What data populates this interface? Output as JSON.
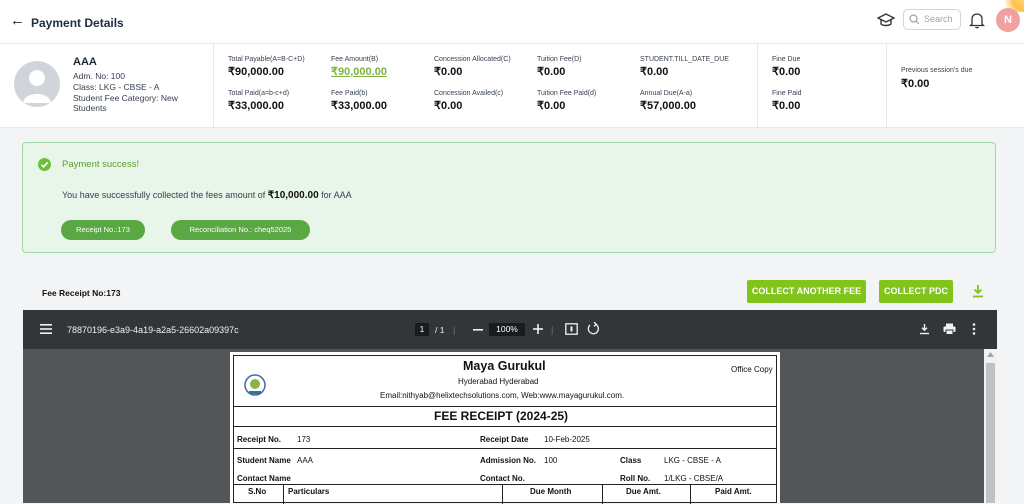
{
  "header": {
    "title": "Payment Details",
    "search_placeholder": "Search",
    "avatar_initial": "N"
  },
  "student": {
    "name": "AAA",
    "adm": "Adm. No: 100",
    "class": "Class: LKG - CBSE - A",
    "category_line1": "Student Fee Category: New",
    "category_line2": "Students"
  },
  "fees": {
    "total_payable_label": "Total Payable(A=B-C+D)",
    "total_payable": "₹90,000.00",
    "fee_amount_label": "Fee Amount(B)",
    "fee_amount": "₹90,000.00",
    "concession_alloc_label": "Concession Allocated(C)",
    "concession_alloc": "₹0.00",
    "tuition_fee_label": "Tuition Fee(D)",
    "tuition_fee": "₹0.00",
    "till_date_due_label": "STUDENT.TILL_DATE_DUE",
    "till_date_due": "₹0.00",
    "total_paid_label": "Total Paid(a=b-c+d)",
    "total_paid": "₹33,000.00",
    "fee_paid_label": "Fee Paid(b)",
    "fee_paid": "₹33,000.00",
    "concession_avail_label": "Concession Availed(c)",
    "concession_avail": "₹0.00",
    "tuition_paid_label": "Tuition Fee Paid(d)",
    "tuition_paid": "₹0.00",
    "annual_due_label": "Annual Due(A-a)",
    "annual_due": "₹57,000.00",
    "fine_due_label": "Fine Due",
    "fine_due": "₹0.00",
    "fine_paid_label": "Fine Paid",
    "fine_paid": "₹0.00",
    "prev_due_label": "Previous session's due",
    "prev_due": "₹0.00"
  },
  "success": {
    "title": "Payment success!",
    "msg_prefix": "You have successfully collected the fees amount of ",
    "amount": "₹10,000.00",
    "msg_suffix": " for AAA",
    "receipt_pill": "Receipt No.:173",
    "reconciliation_pill": "Reconciliation No.: cheq52025"
  },
  "actions": {
    "receipt_label": "Fee Receipt No:173",
    "collect_another": "COLLECT ANOTHER FEE",
    "collect_pdc": "COLLECT PDC"
  },
  "viewer": {
    "doc_id": "78870196-e3a9-4a19-a2a5-26602a09397c",
    "page": "1",
    "page_total": "/ 1",
    "zoom": "100%"
  },
  "receipt": {
    "school": "Maya Gurukul",
    "city": "Hyderabad Hyderabad",
    "contact": "Email:nithyab@helixtechsolutions.com, Web:www.mayagurukul.com.",
    "copy": "Office Copy",
    "heading": "FEE RECEIPT (2024-25)",
    "receipt_no_label": "Receipt No.",
    "receipt_no": "173",
    "receipt_date_label": "Receipt Date",
    "receipt_date": "10-Feb-2025",
    "student_name_label": "Student Name",
    "student_name": "AAA",
    "admission_label": "Admission No.",
    "admission": "100",
    "class_label": "Class",
    "class": "LKG - CBSE - A",
    "contact_name_label": "Contact Name",
    "contact_no_label": "Contact No.",
    "roll_label": "Roll No.",
    "roll": "1/LKG - CBSE/A",
    "cols": [
      "S.No",
      "Particulars",
      "Due Month",
      "Due Amt.",
      "Paid Amt."
    ]
  },
  "colors": {
    "accent_green": "#80c41c",
    "success_bg": "#e8f5e9",
    "pill_green": "#5aa843",
    "viewer_bar": "#323639"
  }
}
